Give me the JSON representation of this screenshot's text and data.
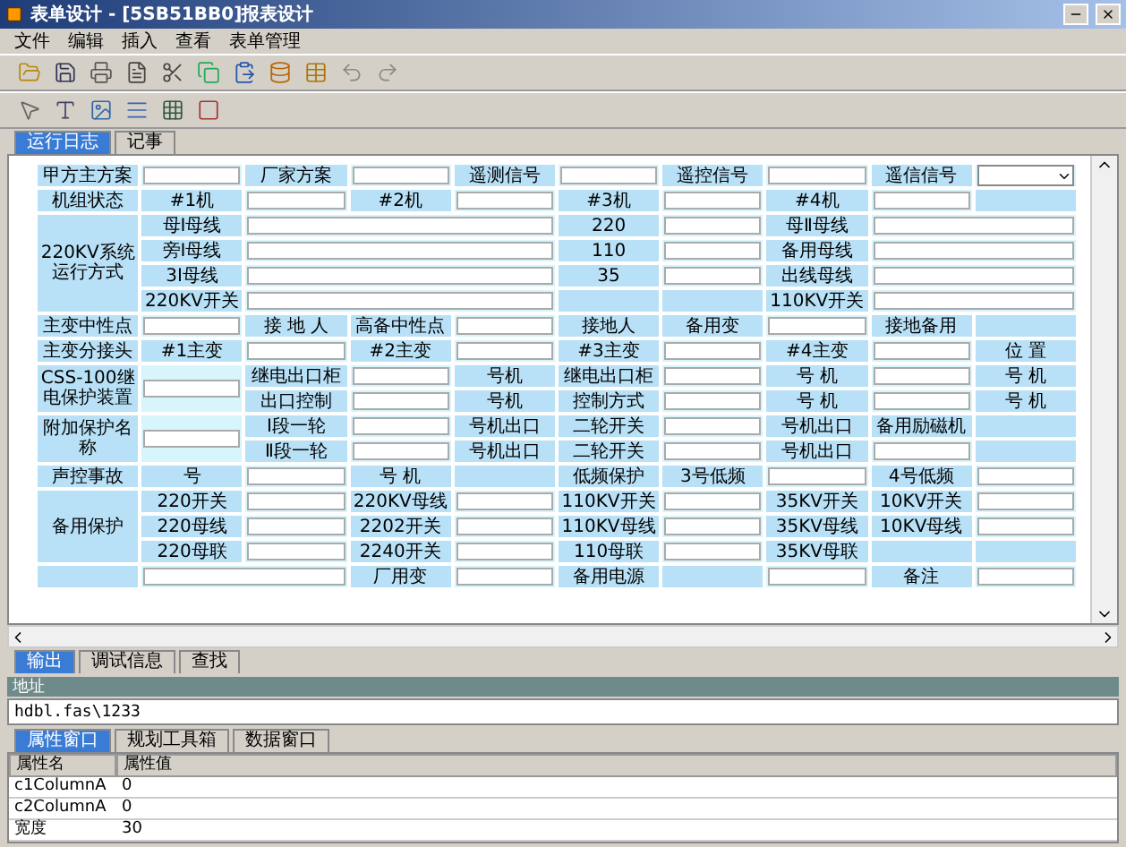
{
  "window": {
    "title": "表单设计 - [5SB51BB0]报表设计"
  },
  "menu": [
    "文件",
    "编辑",
    "插入",
    "查看",
    "表单管理"
  ],
  "doc_tabs": [
    {
      "label": "运行日志",
      "selected": true
    },
    {
      "label": "记事",
      "selected": false
    }
  ],
  "form": {
    "rows": [
      [
        {
          "kind": "label",
          "text": "甲方主方案"
        },
        {
          "kind": "input"
        },
        {
          "kind": "label",
          "text": "厂家方案"
        },
        {
          "kind": "input"
        },
        {
          "kind": "label",
          "text": "遥测信号"
        },
        {
          "kind": "input"
        },
        {
          "kind": "label",
          "text": "遥控信号"
        },
        {
          "kind": "input"
        },
        {
          "kind": "label",
          "text": "遥信信号"
        },
        {
          "kind": "select"
        }
      ],
      [
        {
          "kind": "label",
          "text": "机组状态"
        },
        {
          "kind": "label",
          "text": "#1机"
        },
        {
          "kind": "input"
        },
        {
          "kind": "label",
          "text": "#2机"
        },
        {
          "kind": "input"
        },
        {
          "kind": "label",
          "text": "#3机"
        },
        {
          "kind": "input"
        },
        {
          "kind": "label",
          "text": "#4机"
        },
        {
          "kind": "input"
        },
        {
          "kind": "blank"
        }
      ],
      {
        "side": [
          {
            "kind": "label",
            "text": "220KV系统运行方式"
          }
        ],
        "rows": [
          [
            {
              "kind": "label",
              "text": "母Ⅰ母线"
            },
            {
              "kind": "input",
              "wide": true
            },
            {
              "kind": "label",
              "text": "220"
            },
            {
              "kind": "input"
            },
            {
              "kind": "label",
              "text": "母Ⅱ母线"
            },
            {
              "kind": "input",
              "wide": true
            }
          ],
          [
            {
              "kind": "label",
              "text": "旁Ⅰ母线"
            },
            {
              "kind": "input",
              "wide": true
            },
            {
              "kind": "label",
              "text": "110"
            },
            {
              "kind": "input"
            },
            {
              "kind": "label",
              "text": "备用母线"
            },
            {
              "kind": "input",
              "wide": true
            }
          ],
          [
            {
              "kind": "label",
              "text": "3Ⅰ母线"
            },
            {
              "kind": "input",
              "wide": true
            },
            {
              "kind": "label",
              "text": "35"
            },
            {
              "kind": "input"
            },
            {
              "kind": "label",
              "text": "出线母线"
            },
            {
              "kind": "input",
              "wide": true
            }
          ],
          [
            {
              "kind": "label",
              "text": "220KV开关"
            },
            {
              "kind": "input",
              "wide": true
            },
            {
              "kind": "blank"
            },
            {
              "kind": "blank"
            },
            {
              "kind": "label",
              "text": "110KV开关"
            },
            {
              "kind": "input",
              "wide": true
            }
          ]
        ]
      },
      [
        {
          "kind": "label",
          "text": "主变中性点"
        },
        {
          "kind": "input"
        },
        {
          "kind": "label",
          "text": "接 地 人"
        },
        {
          "kind": "label",
          "text": "高备中性点"
        },
        {
          "kind": "input"
        },
        {
          "kind": "label",
          "text": "接地人"
        },
        {
          "kind": "label",
          "text": "备用变"
        },
        {
          "kind": "input"
        },
        {
          "kind": "label",
          "text": "接地备用"
        },
        {
          "kind": "blank"
        }
      ],
      [
        {
          "kind": "label",
          "text": "主变分接头"
        },
        {
          "kind": "label",
          "text": "#1主变"
        },
        {
          "kind": "input"
        },
        {
          "kind": "label",
          "text": "#2主变"
        },
        {
          "kind": "input"
        },
        {
          "kind": "label",
          "text": "#3主变"
        },
        {
          "kind": "input"
        },
        {
          "kind": "label",
          "text": "#4主变"
        },
        {
          "kind": "input"
        },
        {
          "kind": "label",
          "text": "位 置"
        }
      ],
      {
        "side": [
          {
            "kind": "label",
            "text": "CSS-100继电保护装置"
          },
          {
            "kind": "input"
          }
        ],
        "rows": [
          [
            {
              "kind": "label",
              "text": "继电出口柜"
            },
            {
              "kind": "input"
            },
            {
              "kind": "label",
              "text": "号机"
            },
            {
              "kind": "label",
              "text": "继电出口柜"
            },
            {
              "kind": "input"
            },
            {
              "kind": "label",
              "text": "号 机"
            },
            {
              "kind": "input"
            },
            {
              "kind": "label",
              "text": "号 机"
            }
          ],
          [
            {
              "kind": "label",
              "text": "出口控制"
            },
            {
              "kind": "input"
            },
            {
              "kind": "label",
              "text": "号机"
            },
            {
              "kind": "label",
              "text": "控制方式"
            },
            {
              "kind": "input"
            },
            {
              "kind": "label",
              "text": "号 机"
            },
            {
              "kind": "input"
            },
            {
              "kind": "label",
              "text": "号 机"
            }
          ]
        ]
      },
      {
        "side": [
          {
            "kind": "label",
            "text": "附加保护名称"
          },
          {
            "kind": "input"
          }
        ],
        "rows": [
          [
            {
              "kind": "label",
              "text": "Ⅰ段一轮"
            },
            {
              "kind": "input"
            },
            {
              "kind": "label",
              "text": "号机出口"
            },
            {
              "kind": "label",
              "text": "二轮开关"
            },
            {
              "kind": "input"
            },
            {
              "kind": "label",
              "text": "号机出口"
            },
            {
              "kind": "label",
              "text": "备用励磁机"
            },
            {
              "kind": "blank"
            }
          ],
          [
            {
              "kind": "label",
              "text": "Ⅱ段一轮"
            },
            {
              "kind": "input"
            },
            {
              "kind": "label",
              "text": "号机出口"
            },
            {
              "kind": "label",
              "text": "二轮开关"
            },
            {
              "kind": "input"
            },
            {
              "kind": "label",
              "text": "号机出口"
            },
            {
              "kind": "input"
            },
            {
              "kind": "blank"
            }
          ]
        ]
      },
      [
        {
          "kind": "label",
          "text": "声控事故"
        },
        {
          "kind": "label",
          "text": "号"
        },
        {
          "kind": "input"
        },
        {
          "kind": "label",
          "text": "号 机"
        },
        {
          "kind": "blank"
        },
        {
          "kind": "label",
          "text": "低频保护"
        },
        {
          "kind": "label",
          "text": "3号低频"
        },
        {
          "kind": "input"
        },
        {
          "kind": "label",
          "text": "4号低频"
        },
        {
          "kind": "input"
        }
      ],
      {
        "side": [
          {
            "kind": "label",
            "text": "备用保护"
          }
        ],
        "rows": [
          [
            {
              "kind": "label",
              "text": "220开关"
            },
            {
              "kind": "input"
            },
            {
              "kind": "label",
              "text": "220KV母线"
            },
            {
              "kind": "input"
            },
            {
              "kind": "label",
              "text": "110KV开关"
            },
            {
              "kind": "input"
            },
            {
              "kind": "label",
              "text": "35KV开关"
            },
            {
              "kind": "label",
              "text": "10KV开关"
            },
            {
              "kind": "input"
            }
          ],
          [
            {
              "kind": "label",
              "text": "220母线"
            },
            {
              "kind": "input"
            },
            {
              "kind": "label",
              "text": "2202开关"
            },
            {
              "kind": "input"
            },
            {
              "kind": "label",
              "text": "110KV母线"
            },
            {
              "kind": "input"
            },
            {
              "kind": "label",
              "text": "35KV母线"
            },
            {
              "kind": "label",
              "text": "10KV母线"
            },
            {
              "kind": "input"
            }
          ],
          [
            {
              "kind": "label",
              "text": "220母联"
            },
            {
              "kind": "input"
            },
            {
              "kind": "label",
              "text": "2240开关"
            },
            {
              "kind": "input"
            },
            {
              "kind": "label",
              "text": "110母联"
            },
            {
              "kind": "input"
            },
            {
              "kind": "label",
              "text": "35KV母联"
            },
            {
              "kind": "blank"
            },
            {
              "kind": "blank"
            }
          ]
        ]
      },
      [
        {
          "kind": "blank"
        },
        {
          "kind": "input",
          "wide": true
        },
        {
          "kind": "label",
          "text": "厂用变"
        },
        {
          "kind": "input"
        },
        {
          "kind": "label",
          "text": "备用电源"
        },
        {
          "kind": "blank"
        },
        {
          "kind": "input"
        },
        {
          "kind": "label",
          "text": "备注"
        },
        {
          "kind": "input"
        }
      ]
    ]
  },
  "output_tabs": [
    {
      "label": "输出",
      "selected": true
    },
    {
      "label": "调试信息",
      "selected": false
    },
    {
      "label": "查找",
      "selected": false
    }
  ],
  "address": {
    "label": "地址",
    "value": "hdbl.fas\\1233"
  },
  "panel_tabs": [
    {
      "label": "属性窗口",
      "selected": true
    },
    {
      "label": "规划工具箱",
      "selected": false
    },
    {
      "label": "数据窗口",
      "selected": false
    }
  ],
  "properties": {
    "columns": [
      "属性名",
      "属性值"
    ],
    "rows": [
      [
        "c1ColumnA",
        "0"
      ],
      [
        "c2ColumnA",
        "0"
      ],
      [
        "宽度",
        "30"
      ]
    ]
  }
}
